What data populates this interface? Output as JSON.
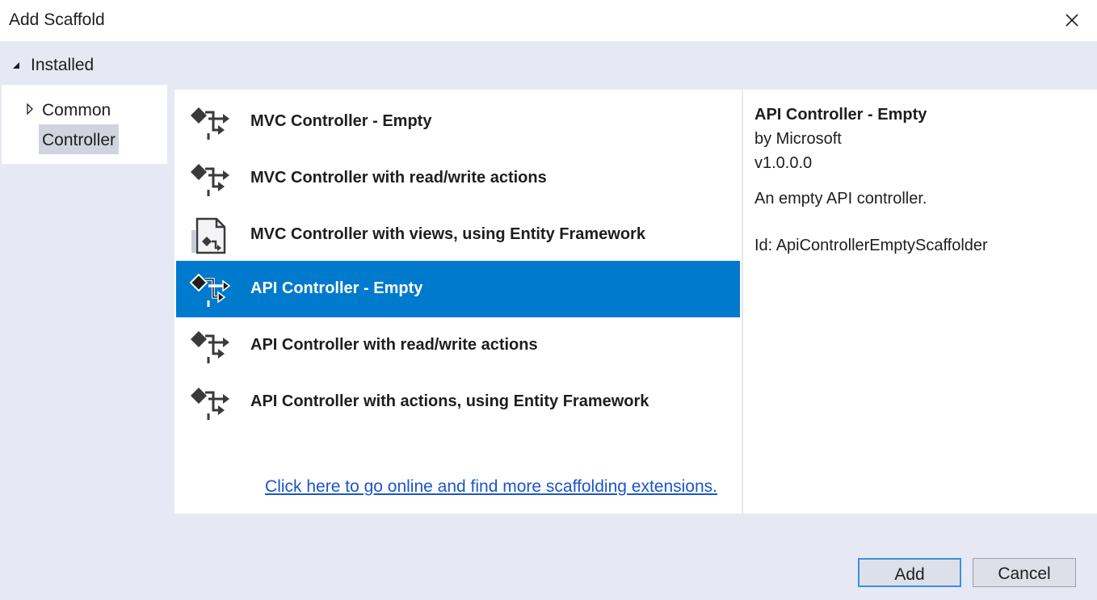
{
  "window": {
    "title": "Add Scaffold",
    "close_icon": "close-icon"
  },
  "installed": {
    "label": "Installed",
    "expanded": true
  },
  "tree": {
    "items": [
      {
        "label": "Common",
        "expanded": false,
        "selected": false
      },
      {
        "label": "Controller",
        "selected": true
      }
    ]
  },
  "scaffolders": [
    {
      "label": "MVC Controller - Empty",
      "icon": "controller-icon",
      "selected": false
    },
    {
      "label": "MVC Controller with read/write actions",
      "icon": "controller-icon",
      "selected": false
    },
    {
      "label": "MVC Controller with views, using Entity Framework",
      "icon": "controller-views-icon",
      "selected": false
    },
    {
      "label": "API Controller - Empty",
      "icon": "controller-icon",
      "selected": true
    },
    {
      "label": "API Controller with read/write actions",
      "icon": "controller-icon",
      "selected": false
    },
    {
      "label": "API Controller with actions, using Entity Framework",
      "icon": "controller-icon",
      "selected": false
    }
  ],
  "online_link": "Click here to go online and find more scaffolding extensions.",
  "details": {
    "title": "API Controller - Empty",
    "author": "by Microsoft",
    "version": "v1.0.0.0",
    "description": "An empty API controller.",
    "id": "Id: ApiControllerEmptyScaffolder"
  },
  "buttons": {
    "add": "Add",
    "cancel": "Cancel"
  },
  "colors": {
    "selection": "#007acc",
    "link": "#1a56c8",
    "background": "#e6e9f3"
  }
}
